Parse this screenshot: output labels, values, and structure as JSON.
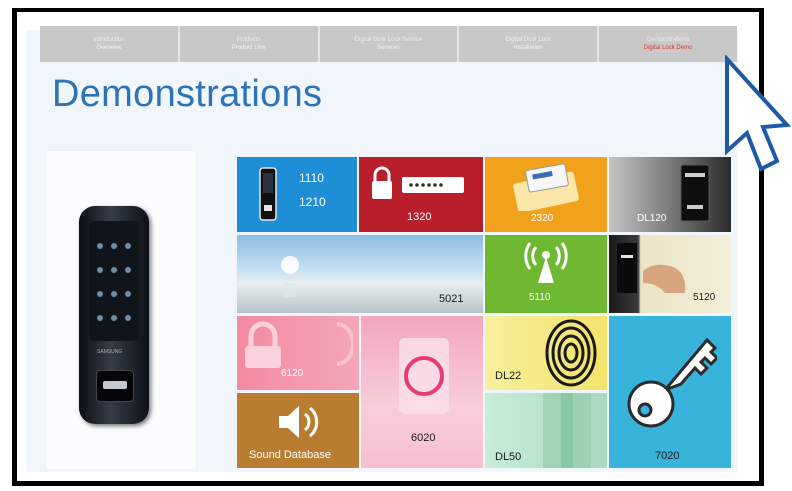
{
  "nav": {
    "items": [
      {
        "top": "Introduction",
        "sub": "Overview"
      },
      {
        "top": "Products",
        "sub": "Product Line"
      },
      {
        "top": "Digital Door Lock Service",
        "sub": "Services"
      },
      {
        "top": "Digital Door Lock",
        "sub": "Installation"
      },
      {
        "top": "Demonstrations",
        "sub": "Digital Lock Demo"
      }
    ],
    "active_index": 4
  },
  "page": {
    "title": "Demonstrations"
  },
  "product": {
    "brand": "SAMSUNG"
  },
  "tiles": [
    {
      "id": "1110-1210",
      "label_line1": "1110",
      "label_line2": "1210",
      "color": "#1e8fd6",
      "icon": "door-lock-icon"
    },
    {
      "id": "1320",
      "label": "1320",
      "color": "#b81f2b",
      "icon": "password-lock-icon"
    },
    {
      "id": "2320",
      "label": "2320",
      "color": "#f2a21a",
      "icon": "card-key-icon"
    },
    {
      "id": "dl120",
      "label": "DL120",
      "color": "#8a8a8a",
      "icon": "door-lock-photo-icon"
    },
    {
      "id": "5021",
      "label": "5021",
      "color": "#9cc6e4",
      "icon": "sky-photo"
    },
    {
      "id": "5110",
      "label": "5110",
      "color": "#6fb832",
      "icon": "wireless-signal-icon"
    },
    {
      "id": "5120",
      "label": "5120",
      "color": "#ece4c6",
      "icon": "hand-door-icon"
    },
    {
      "id": "6120",
      "label": "6120",
      "color": "#ef8aa2",
      "icon": "padlock-icon"
    },
    {
      "id": "6020",
      "label": "6020",
      "color": "#f4b8c8",
      "icon": "ring-button-icon"
    },
    {
      "id": "dl22",
      "label": "DL22",
      "color": "#f2e36a",
      "icon": "fingerprint-icon"
    },
    {
      "id": "7020",
      "label": "7020",
      "color": "#38b4dc",
      "icon": "key-icon"
    },
    {
      "id": "sound-database",
      "label": "Sound Database",
      "color": "#b87d30",
      "icon": "speaker-icon"
    },
    {
      "id": "dl50",
      "label": "DL50",
      "color": "#b6e2cc",
      "icon": "door-photo-icon"
    }
  ]
}
